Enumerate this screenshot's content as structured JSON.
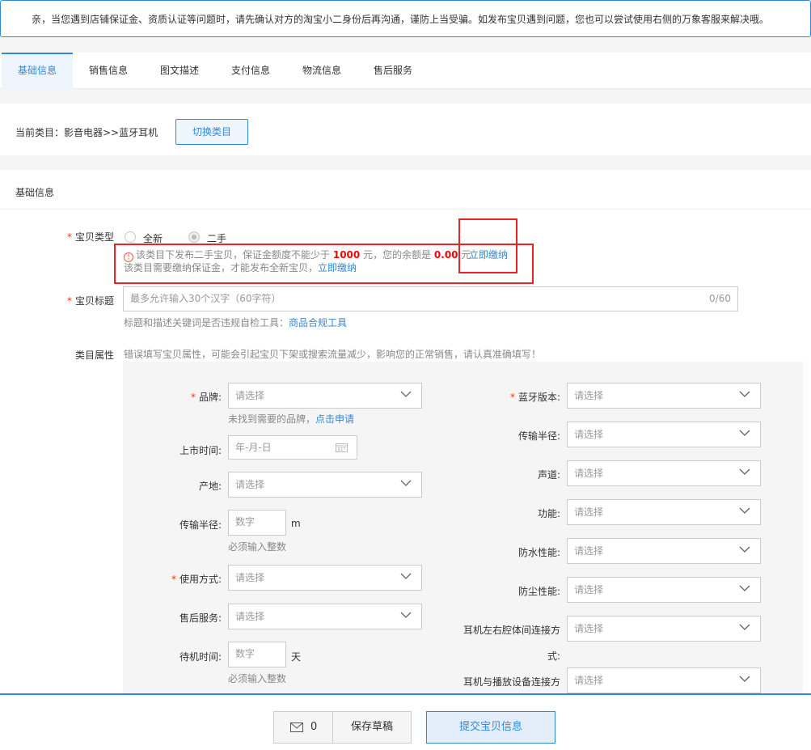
{
  "notice": "亲，当您遇到店铺保证金、资质认证等问题时，请先确认对方的淘宝小二身份后再沟通，谨防上当受骗。如发布宝贝遇到问题，您也可以尝试使用右侧的万象客服来解决哦。",
  "tabs": [
    {
      "label": "基础信息",
      "active": true
    },
    {
      "label": "销售信息"
    },
    {
      "label": "图文描述"
    },
    {
      "label": "支付信息"
    },
    {
      "label": "物流信息"
    },
    {
      "label": "售后服务"
    }
  ],
  "category": {
    "label": "当前类目：影音电器>>蓝牙耳机",
    "switch_button": "切换类目"
  },
  "section_title": "基础信息",
  "item_type": {
    "label": "宝贝类型",
    "options": [
      "全新",
      "二手"
    ],
    "warning_prefix": "该类目下发布二手宝贝，保证金额度不能少于",
    "warning_amount": "1000",
    "warning_mid": "元，您的余额是",
    "warning_balance": "0.00",
    "warning_unit": "元",
    "pay_link_1": "立即缴纳",
    "warning_line2": "该类目需要缴纳保证金，才能发布全新宝贝，",
    "pay_link_2": "立即缴纳"
  },
  "title_field": {
    "label": "宝贝标题",
    "placeholder": "最多允许输入30个汉字（60字符）",
    "counter": "0/60",
    "hint": "标题和描述关键词是否违规自检工具：",
    "hint_link": "商品合规工具"
  },
  "attributes": {
    "label": "类目属性",
    "warning": "错误填写宝贝属性，可能会引起宝贝下架或搜索流量减少，影响您的正常销售，请认真准确填写！",
    "left": {
      "brand": "品牌:",
      "brand_value": "请选择",
      "brand_hint": "未找到需要的品牌，",
      "brand_link": "点击申请",
      "launch_time": "上市时间:",
      "launch_placeholder": "年-月-日",
      "origin": "产地:",
      "origin_value": "请选择",
      "range": "传输半径:",
      "range_placeholder": "数字",
      "range_unit": "m",
      "range_hint": "必须输入整数",
      "usage": "使用方式:",
      "usage_value": "请选择",
      "after_sale": "售后服务:",
      "after_sale_value": "请选择",
      "standby": "待机时间:",
      "standby_placeholder": "数字",
      "standby_unit": "天",
      "standby_hint": "必须输入整数"
    },
    "right": {
      "bt_version": "蓝牙版本:",
      "range": "传输半径:",
      "channel": "声道:",
      "function": "功能:",
      "waterproof": "防水性能:",
      "dustproof": "防尘性能:",
      "lr_connect_1": "耳机左右腔体间连接方",
      "lr_connect_2": "式:",
      "device_connect": "耳机与播放设备连接方",
      "select_value": "请选择"
    }
  },
  "bottom": {
    "msg_count": "0",
    "draft": "保存草稿",
    "submit": "提交宝贝信息"
  },
  "colors": {
    "accent": "#3089dc",
    "alert": "#e8242b",
    "required": "#ff3300"
  }
}
